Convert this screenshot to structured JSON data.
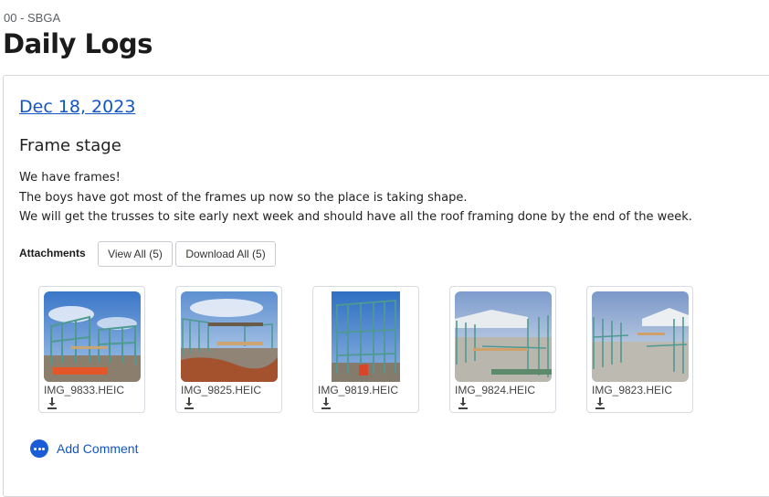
{
  "header": {
    "project_code": "00 - SBGA",
    "title": "Daily Logs"
  },
  "log": {
    "date": "Dec 18, 2023",
    "title": "Frame stage",
    "body": [
      "We have frames!",
      "The boys have got most of the frames up now so the place is taking shape.",
      "We will get the trusses to site early next week and should have all the roof framing done by the end of the week."
    ]
  },
  "attachments": {
    "label": "Attachments",
    "view_all": "View All (5)",
    "download_all": "Download All (5)",
    "files": [
      {
        "name": "IMG_9833.HEIC"
      },
      {
        "name": "IMG_9825.HEIC"
      },
      {
        "name": "IMG_9819.HEIC"
      },
      {
        "name": "IMG_9824.HEIC"
      },
      {
        "name": "IMG_9823.HEIC"
      }
    ]
  },
  "comment": {
    "add_label": "Add Comment"
  },
  "colors": {
    "link": "#1256c4",
    "accent": "#1a5dd6",
    "frame": "#4e9a93"
  }
}
